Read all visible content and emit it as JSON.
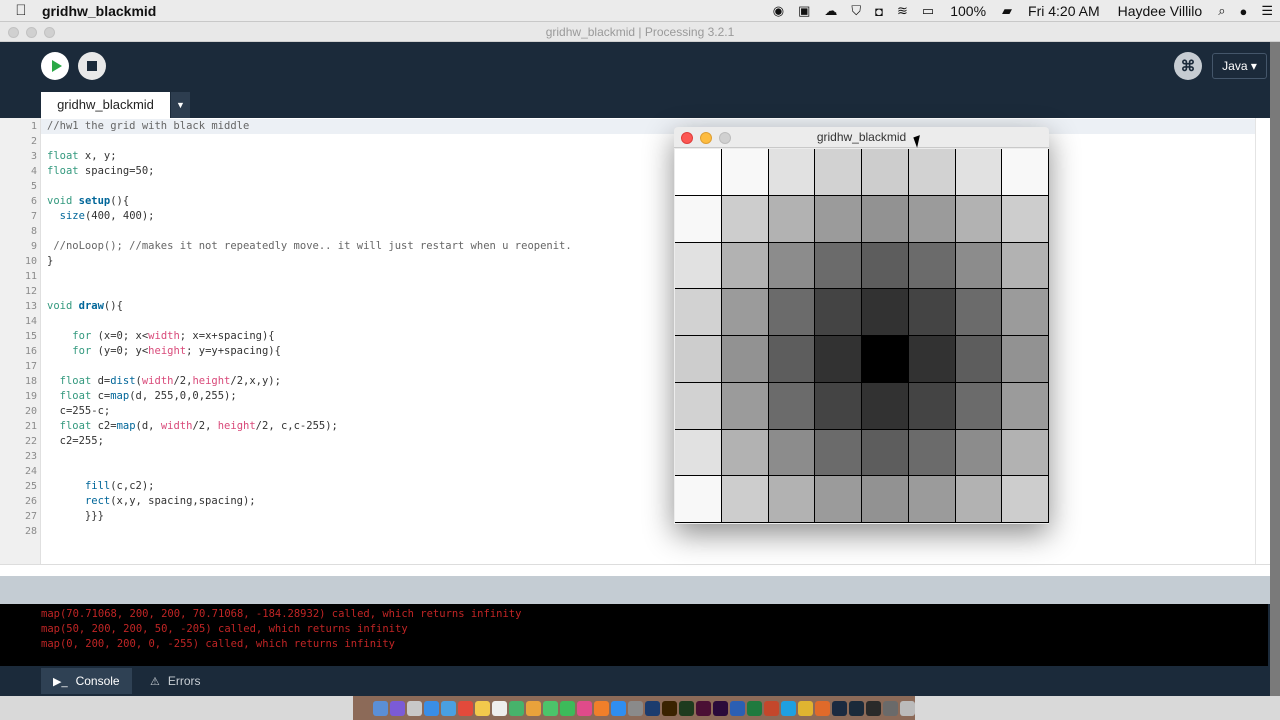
{
  "menubar": {
    "apple": "",
    "app_name": "gridhw_blackmid",
    "battery": "100%",
    "clock": "Fri 4:20 AM",
    "user": "Haydee Villilo",
    "status_icons": [
      "screen-record-icon",
      "app-icon",
      "cloud-icon",
      "shield-icon",
      "camera-icon",
      "wifi-icon",
      "airplay-icon",
      "battery-icon"
    ]
  },
  "window": {
    "title": "gridhw_blackmid | Processing 3.2.1"
  },
  "toolbar": {
    "mode": "Java ▾",
    "debug_glyph": "⌘"
  },
  "tabs": [
    {
      "label": "gridhw_blackmid"
    }
  ],
  "tab_menu_glyph": "▼",
  "editor": {
    "line_numbers": [
      "1",
      "2",
      "3",
      "4",
      "5",
      "6",
      "7",
      "8",
      "9",
      "10",
      "11",
      "12",
      "13",
      "14",
      "15",
      "16",
      "17",
      "18",
      "19",
      "20",
      "21",
      "22",
      "23",
      "24",
      "25",
      "26",
      "27",
      "28"
    ]
  },
  "console": {
    "lines": [
      "map(70.71068, 200, 200, 70.71068, -184.28932) called, which returns infinity",
      "map(50, 200, 200, 50, -205) called, which returns infinity",
      "map(0, 200, 200, 0, -255) called, which returns infinity"
    ],
    "tabs": [
      {
        "label": "Console"
      },
      {
        "label": "Errors"
      }
    ]
  },
  "sketch_window": {
    "title": "gridhw_blackmid",
    "cell_grays": [
      [
        255,
        248,
        225,
        210,
        205,
        210,
        225,
        248
      ],
      [
        248,
        205,
        178,
        155,
        146,
        155,
        178,
        205
      ],
      [
        225,
        178,
        140,
        107,
        93,
        107,
        140,
        178
      ],
      [
        210,
        155,
        107,
        68,
        50,
        68,
        107,
        155
      ],
      [
        205,
        146,
        93,
        50,
        0,
        50,
        93,
        146
      ],
      [
        210,
        155,
        107,
        68,
        50,
        68,
        107,
        155
      ],
      [
        225,
        178,
        140,
        107,
        93,
        107,
        140,
        178
      ],
      [
        248,
        205,
        178,
        155,
        146,
        155,
        178,
        205
      ]
    ]
  },
  "dock": {
    "icons": [
      "finder",
      "siri",
      "launchpad",
      "safari",
      "mail",
      "calendar",
      "notes",
      "reminders",
      "maps",
      "photos",
      "messages",
      "facetime",
      "itunes",
      "ibooks",
      "appstore",
      "prefs",
      "photoshop",
      "illustrator",
      "dreamweaver",
      "indesign",
      "premiere",
      "word",
      "excel",
      "powerpoint",
      "skype",
      "chrome",
      "firefox",
      "steam",
      "processing",
      "quicktime",
      "system",
      "trash"
    ]
  }
}
